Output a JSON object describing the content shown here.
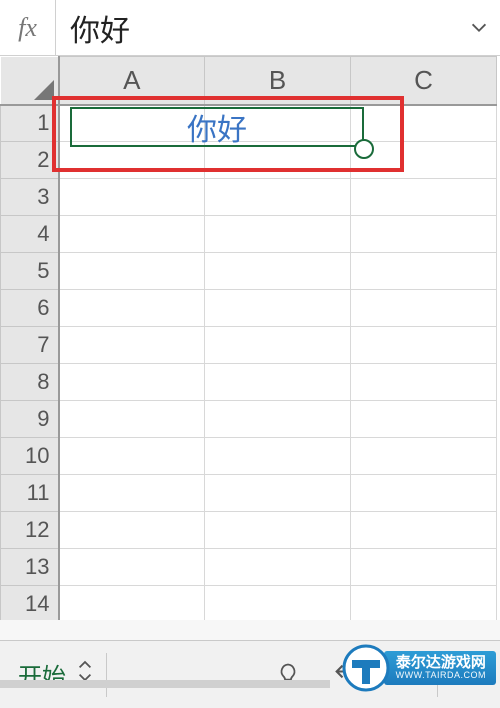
{
  "formula_bar": {
    "fx_label": "fx",
    "value": "你好",
    "expand_glyph": "chevron-down"
  },
  "columns": {
    "A": "A",
    "B": "B",
    "C": "C"
  },
  "rows": [
    "1",
    "2",
    "3",
    "4",
    "5",
    "6",
    "7",
    "8",
    "9",
    "10",
    "11",
    "12",
    "13",
    "14"
  ],
  "cell_content": {
    "A1B1_merged_value": "你好",
    "A1B1_text_color": "#3a74c4",
    "selection_border_color": "#1a6b3a"
  },
  "highlight_box_color": "#e03030",
  "toolbar": {
    "tab_label": "开始",
    "bulb_icon": "lightbulb",
    "undo_icon": "undo",
    "redo_icon": "redo",
    "more_icon": "chevron-down"
  },
  "watermark": {
    "title": "泰尔达游戏网",
    "host": "WWW.TAIRDA.COM"
  }
}
